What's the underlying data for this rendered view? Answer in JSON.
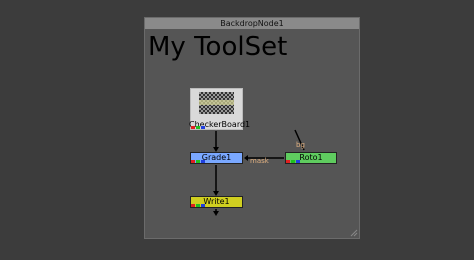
{
  "backdrop": {
    "title": "BackdropNode1",
    "heading": "My ToolSet"
  },
  "nodes": {
    "checker": {
      "label": "CheckerBoard1"
    },
    "grade": {
      "label": "Grade1"
    },
    "roto": {
      "label": "Roto1"
    },
    "write": {
      "label": "Write1"
    }
  },
  "edges": {
    "mask_label": "mask",
    "bg_label": "bg"
  },
  "colors": {
    "grade": "#7aa8ff",
    "roto": "#5fcc5f",
    "write": "#d0cf20",
    "channel_red": "#e02020",
    "channel_green": "#20c020",
    "channel_blue": "#2040e0"
  }
}
